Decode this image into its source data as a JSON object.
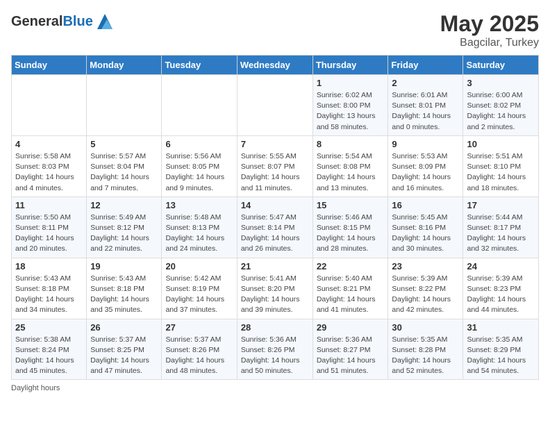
{
  "header": {
    "logo_general": "General",
    "logo_blue": "Blue",
    "main_title": "May 2025",
    "sub_title": "Bagcilar, Turkey"
  },
  "calendar": {
    "days_of_week": [
      "Sunday",
      "Monday",
      "Tuesday",
      "Wednesday",
      "Thursday",
      "Friday",
      "Saturday"
    ],
    "weeks": [
      [
        {
          "day": "",
          "info": ""
        },
        {
          "day": "",
          "info": ""
        },
        {
          "day": "",
          "info": ""
        },
        {
          "day": "",
          "info": ""
        },
        {
          "day": "1",
          "info": "Sunrise: 6:02 AM\nSunset: 8:00 PM\nDaylight: 13 hours and 58 minutes."
        },
        {
          "day": "2",
          "info": "Sunrise: 6:01 AM\nSunset: 8:01 PM\nDaylight: 14 hours and 0 minutes."
        },
        {
          "day": "3",
          "info": "Sunrise: 6:00 AM\nSunset: 8:02 PM\nDaylight: 14 hours and 2 minutes."
        }
      ],
      [
        {
          "day": "4",
          "info": "Sunrise: 5:58 AM\nSunset: 8:03 PM\nDaylight: 14 hours and 4 minutes."
        },
        {
          "day": "5",
          "info": "Sunrise: 5:57 AM\nSunset: 8:04 PM\nDaylight: 14 hours and 7 minutes."
        },
        {
          "day": "6",
          "info": "Sunrise: 5:56 AM\nSunset: 8:05 PM\nDaylight: 14 hours and 9 minutes."
        },
        {
          "day": "7",
          "info": "Sunrise: 5:55 AM\nSunset: 8:07 PM\nDaylight: 14 hours and 11 minutes."
        },
        {
          "day": "8",
          "info": "Sunrise: 5:54 AM\nSunset: 8:08 PM\nDaylight: 14 hours and 13 minutes."
        },
        {
          "day": "9",
          "info": "Sunrise: 5:53 AM\nSunset: 8:09 PM\nDaylight: 14 hours and 16 minutes."
        },
        {
          "day": "10",
          "info": "Sunrise: 5:51 AM\nSunset: 8:10 PM\nDaylight: 14 hours and 18 minutes."
        }
      ],
      [
        {
          "day": "11",
          "info": "Sunrise: 5:50 AM\nSunset: 8:11 PM\nDaylight: 14 hours and 20 minutes."
        },
        {
          "day": "12",
          "info": "Sunrise: 5:49 AM\nSunset: 8:12 PM\nDaylight: 14 hours and 22 minutes."
        },
        {
          "day": "13",
          "info": "Sunrise: 5:48 AM\nSunset: 8:13 PM\nDaylight: 14 hours and 24 minutes."
        },
        {
          "day": "14",
          "info": "Sunrise: 5:47 AM\nSunset: 8:14 PM\nDaylight: 14 hours and 26 minutes."
        },
        {
          "day": "15",
          "info": "Sunrise: 5:46 AM\nSunset: 8:15 PM\nDaylight: 14 hours and 28 minutes."
        },
        {
          "day": "16",
          "info": "Sunrise: 5:45 AM\nSunset: 8:16 PM\nDaylight: 14 hours and 30 minutes."
        },
        {
          "day": "17",
          "info": "Sunrise: 5:44 AM\nSunset: 8:17 PM\nDaylight: 14 hours and 32 minutes."
        }
      ],
      [
        {
          "day": "18",
          "info": "Sunrise: 5:43 AM\nSunset: 8:18 PM\nDaylight: 14 hours and 34 minutes."
        },
        {
          "day": "19",
          "info": "Sunrise: 5:43 AM\nSunset: 8:18 PM\nDaylight: 14 hours and 35 minutes."
        },
        {
          "day": "20",
          "info": "Sunrise: 5:42 AM\nSunset: 8:19 PM\nDaylight: 14 hours and 37 minutes."
        },
        {
          "day": "21",
          "info": "Sunrise: 5:41 AM\nSunset: 8:20 PM\nDaylight: 14 hours and 39 minutes."
        },
        {
          "day": "22",
          "info": "Sunrise: 5:40 AM\nSunset: 8:21 PM\nDaylight: 14 hours and 41 minutes."
        },
        {
          "day": "23",
          "info": "Sunrise: 5:39 AM\nSunset: 8:22 PM\nDaylight: 14 hours and 42 minutes."
        },
        {
          "day": "24",
          "info": "Sunrise: 5:39 AM\nSunset: 8:23 PM\nDaylight: 14 hours and 44 minutes."
        }
      ],
      [
        {
          "day": "25",
          "info": "Sunrise: 5:38 AM\nSunset: 8:24 PM\nDaylight: 14 hours and 45 minutes."
        },
        {
          "day": "26",
          "info": "Sunrise: 5:37 AM\nSunset: 8:25 PM\nDaylight: 14 hours and 47 minutes."
        },
        {
          "day": "27",
          "info": "Sunrise: 5:37 AM\nSunset: 8:26 PM\nDaylight: 14 hours and 48 minutes."
        },
        {
          "day": "28",
          "info": "Sunrise: 5:36 AM\nSunset: 8:26 PM\nDaylight: 14 hours and 50 minutes."
        },
        {
          "day": "29",
          "info": "Sunrise: 5:36 AM\nSunset: 8:27 PM\nDaylight: 14 hours and 51 minutes."
        },
        {
          "day": "30",
          "info": "Sunrise: 5:35 AM\nSunset: 8:28 PM\nDaylight: 14 hours and 52 minutes."
        },
        {
          "day": "31",
          "info": "Sunrise: 5:35 AM\nSunset: 8:29 PM\nDaylight: 14 hours and 54 minutes."
        }
      ]
    ]
  },
  "footer": {
    "daylight_label": "Daylight hours"
  }
}
